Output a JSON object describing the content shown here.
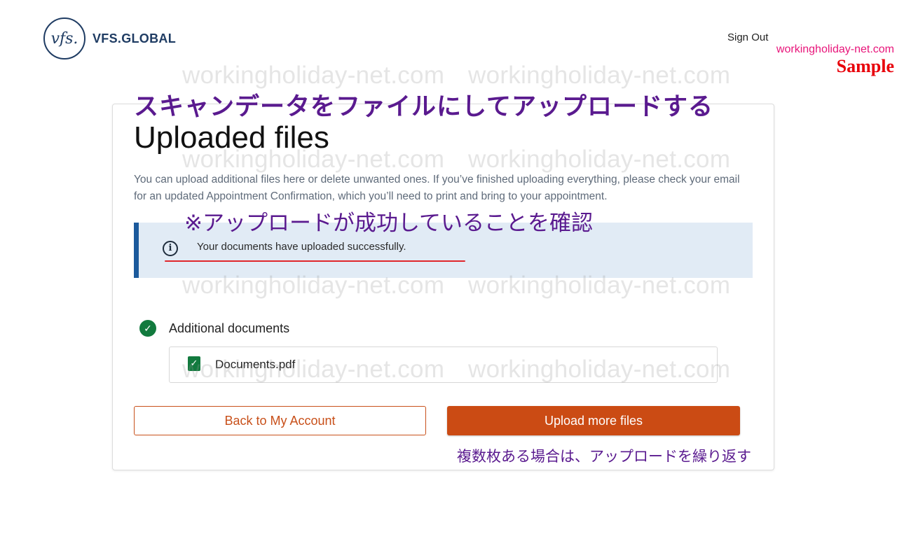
{
  "header": {
    "logo_mark": "vfs.",
    "logo_text": "VFS.GLOBAL",
    "sign_out": "Sign Out",
    "site_mark": "workingholiday-net.com",
    "sample_mark": "Sample"
  },
  "annotations": {
    "title_jp": "スキャンデータをファイルにしてアップロードする",
    "note_jp": "※アップロードが成功していることを確認",
    "hint_jp": "複数枚ある場合は、アップロードを繰り返す"
  },
  "main": {
    "title": "Uploaded files",
    "description": "You can upload additional files here or delete unwanted ones. If you’ve finished uploading everything, please check your email for an updated Appointment Confirmation, which you’ll need to print and bring to your appointment.",
    "alert": {
      "icon": "info-icon",
      "text": "Your documents have uploaded successfully."
    },
    "section": {
      "icon": "check-circle-icon",
      "label": "Additional documents",
      "files": [
        {
          "icon": "checkbox-checked-icon",
          "name": "Documents.pdf"
        }
      ]
    },
    "buttons": {
      "back": "Back to My Account",
      "upload": "Upload more files"
    }
  },
  "watermark": "workingholiday-net.com",
  "colors": {
    "accent": "#cb4b14",
    "success": "#127a3e",
    "alert_bg": "#e1ebf5",
    "alert_border": "#1b5a9c",
    "annotation": "#5a1a8f",
    "brand": "#1f3c63"
  }
}
